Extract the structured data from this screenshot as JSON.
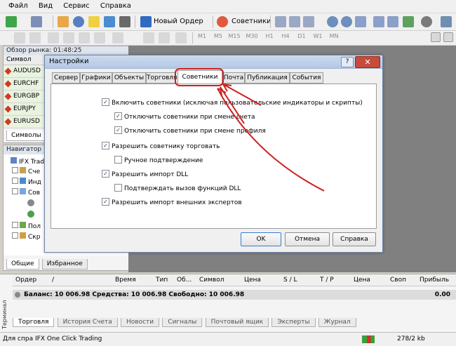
{
  "menu": [
    "Файл",
    "Вид",
    "Сервис",
    "Справка"
  ],
  "toolbar": {
    "new_order": "Новый Ордер",
    "advisors": "Советники"
  },
  "timeframes": [
    "M1",
    "M5",
    "M15",
    "M30",
    "H1",
    "H4",
    "D1",
    "W1",
    "MN"
  ],
  "market_watch": {
    "title": "Обзор рынка: 01:48:25",
    "column": "Символ",
    "symbols": [
      "AUDUSD",
      "EURCHF",
      "EURGBP",
      "EURJPY",
      "EURUSD"
    ],
    "tab": "Символы"
  },
  "navigator": {
    "title": "Навигатор",
    "items": [
      "IFX Trad",
      "Сче",
      "Инд",
      "Сов",
      "Пол",
      "Скр"
    ],
    "tabs": [
      "Общие",
      "Избранное"
    ]
  },
  "dialog": {
    "title": "Настройки",
    "help": "?",
    "close": "✕",
    "tabs": [
      "Сервер",
      "Графики",
      "Объекты",
      "Торговля",
      "Советники",
      "Почта",
      "Публикация",
      "События"
    ],
    "active_tab": "Советники",
    "options": [
      {
        "label": "Включить советники (исключая пользовательские индикаторы и скрипты)",
        "checked": true
      },
      {
        "label": "Отключить советники при смене счета",
        "checked": true
      },
      {
        "label": "Отключить советники при смене профиля",
        "checked": true
      },
      {
        "label": "Разрешить советнику торговать",
        "checked": true
      },
      {
        "label": "Ручное подтверждение",
        "checked": false
      },
      {
        "label": "Разрешить импорт DLL",
        "checked": true
      },
      {
        "label": "Подтверждать вызов функций DLL",
        "checked": false
      },
      {
        "label": "Разрешить импорт внешних экспертов",
        "checked": true
      }
    ],
    "buttons": {
      "ok": "OK",
      "cancel": "Отмена",
      "help": "Справка"
    }
  },
  "terminal": {
    "label": "Терминал",
    "columns": [
      "Ордер",
      "/",
      "Время",
      "Тип",
      "Об...",
      "Символ",
      "Цена",
      "S / L",
      "T / P",
      "Цена",
      "Своп",
      "Прибыль"
    ],
    "balance_text": "Баланс: 10 006.98  Средства: 10 006.98  Свободно: 10 006.98",
    "balance_value": "0.00",
    "tabs": [
      "Торговля",
      "История Счета",
      "Новости",
      "Сигналы",
      "Почтовый ящик",
      "Эксперты",
      "Журнал"
    ]
  },
  "status": {
    "help": "Для спра",
    "profile": "IFX One Click Trading",
    "traffic": "278/2 kb"
  },
  "colors": {
    "annotation": "#cc2020",
    "dialog_title": "#c2d3ea",
    "chart_bg": "#808080"
  }
}
